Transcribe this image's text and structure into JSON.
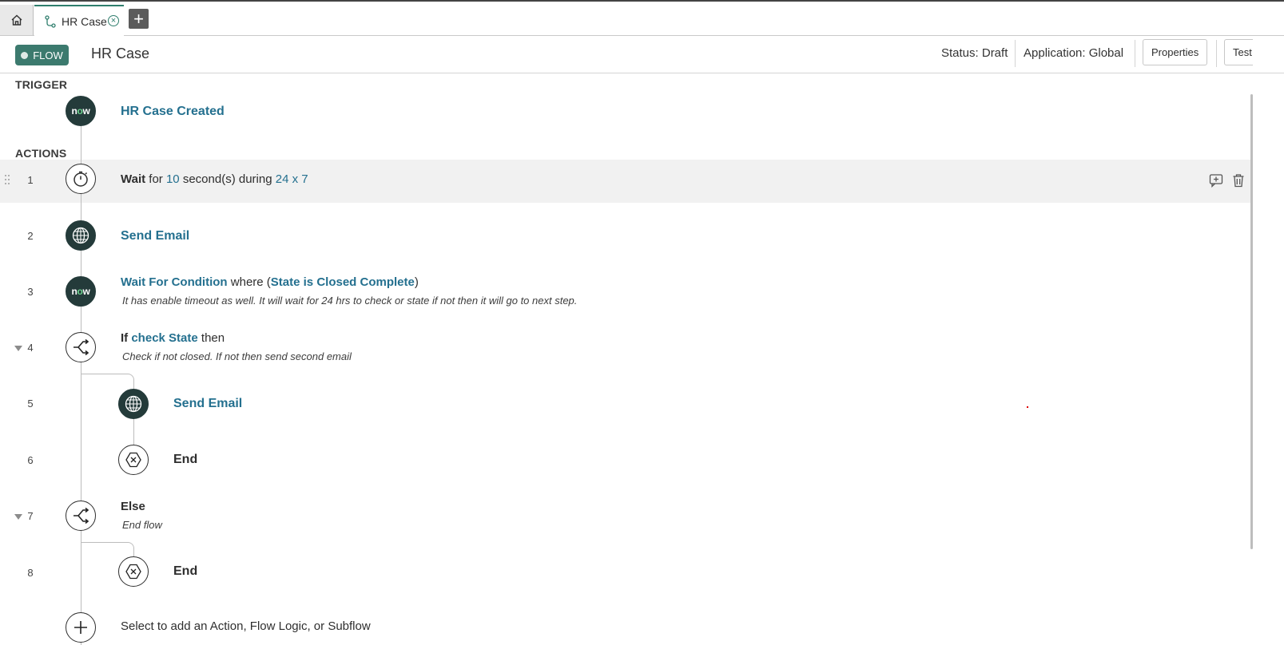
{
  "tabs": {
    "home_icon": "home-icon",
    "active_tab": {
      "label": "HR Case",
      "icon": "flow-icon",
      "close_icon": "close-circle-icon"
    },
    "new_tab_icon": "plus-icon"
  },
  "header": {
    "badge": "FLOW",
    "title": "HR Case",
    "status": "Status: Draft",
    "application": "Application: Global",
    "properties_label": "Properties",
    "test_label": "Test"
  },
  "trigger": {
    "section_label": "TRIGGER",
    "name": "HR Case Created",
    "icon": "now-logo",
    "logo_text": {
      "n": "n",
      "o": "o",
      "w": "w"
    }
  },
  "actions": {
    "section_label": "ACTIONS",
    "steps": [
      {
        "num": "1",
        "icon": "timer-icon",
        "label": "Wait",
        "for": "for",
        "value": "10",
        "mid": "second(s) during",
        "schedule": "24 x 7"
      },
      {
        "num": "2",
        "icon": "globe-icon",
        "label": "Send Email"
      },
      {
        "num": "3",
        "icon": "now-logo",
        "label": "Wait For Condition",
        "where": "where (",
        "condition": "State is Closed Complete",
        "close": ")",
        "note": "It has enable timeout as well. It will wait for 24 hrs to check or state if not then it will go to next step."
      },
      {
        "num": "4",
        "icon": "branch-icon",
        "if": "If",
        "condition": "check State",
        "then": "then",
        "note": "Check if not closed. If not then send second email"
      },
      {
        "num": "5",
        "icon": "globe-icon",
        "label": "Send Email"
      },
      {
        "num": "6",
        "icon": "end-icon",
        "label": "End"
      },
      {
        "num": "7",
        "icon": "branch-icon",
        "label": "Else",
        "note": "End flow"
      },
      {
        "num": "8",
        "icon": "end-icon",
        "label": "End"
      }
    ],
    "add_prompt": "Select to add an Action, Flow Logic, or Subflow"
  },
  "colors": {
    "accent": "#2f7e6d",
    "link": "#24708f",
    "dark_node": "#243b3a",
    "badge": "#3c7a6e"
  }
}
